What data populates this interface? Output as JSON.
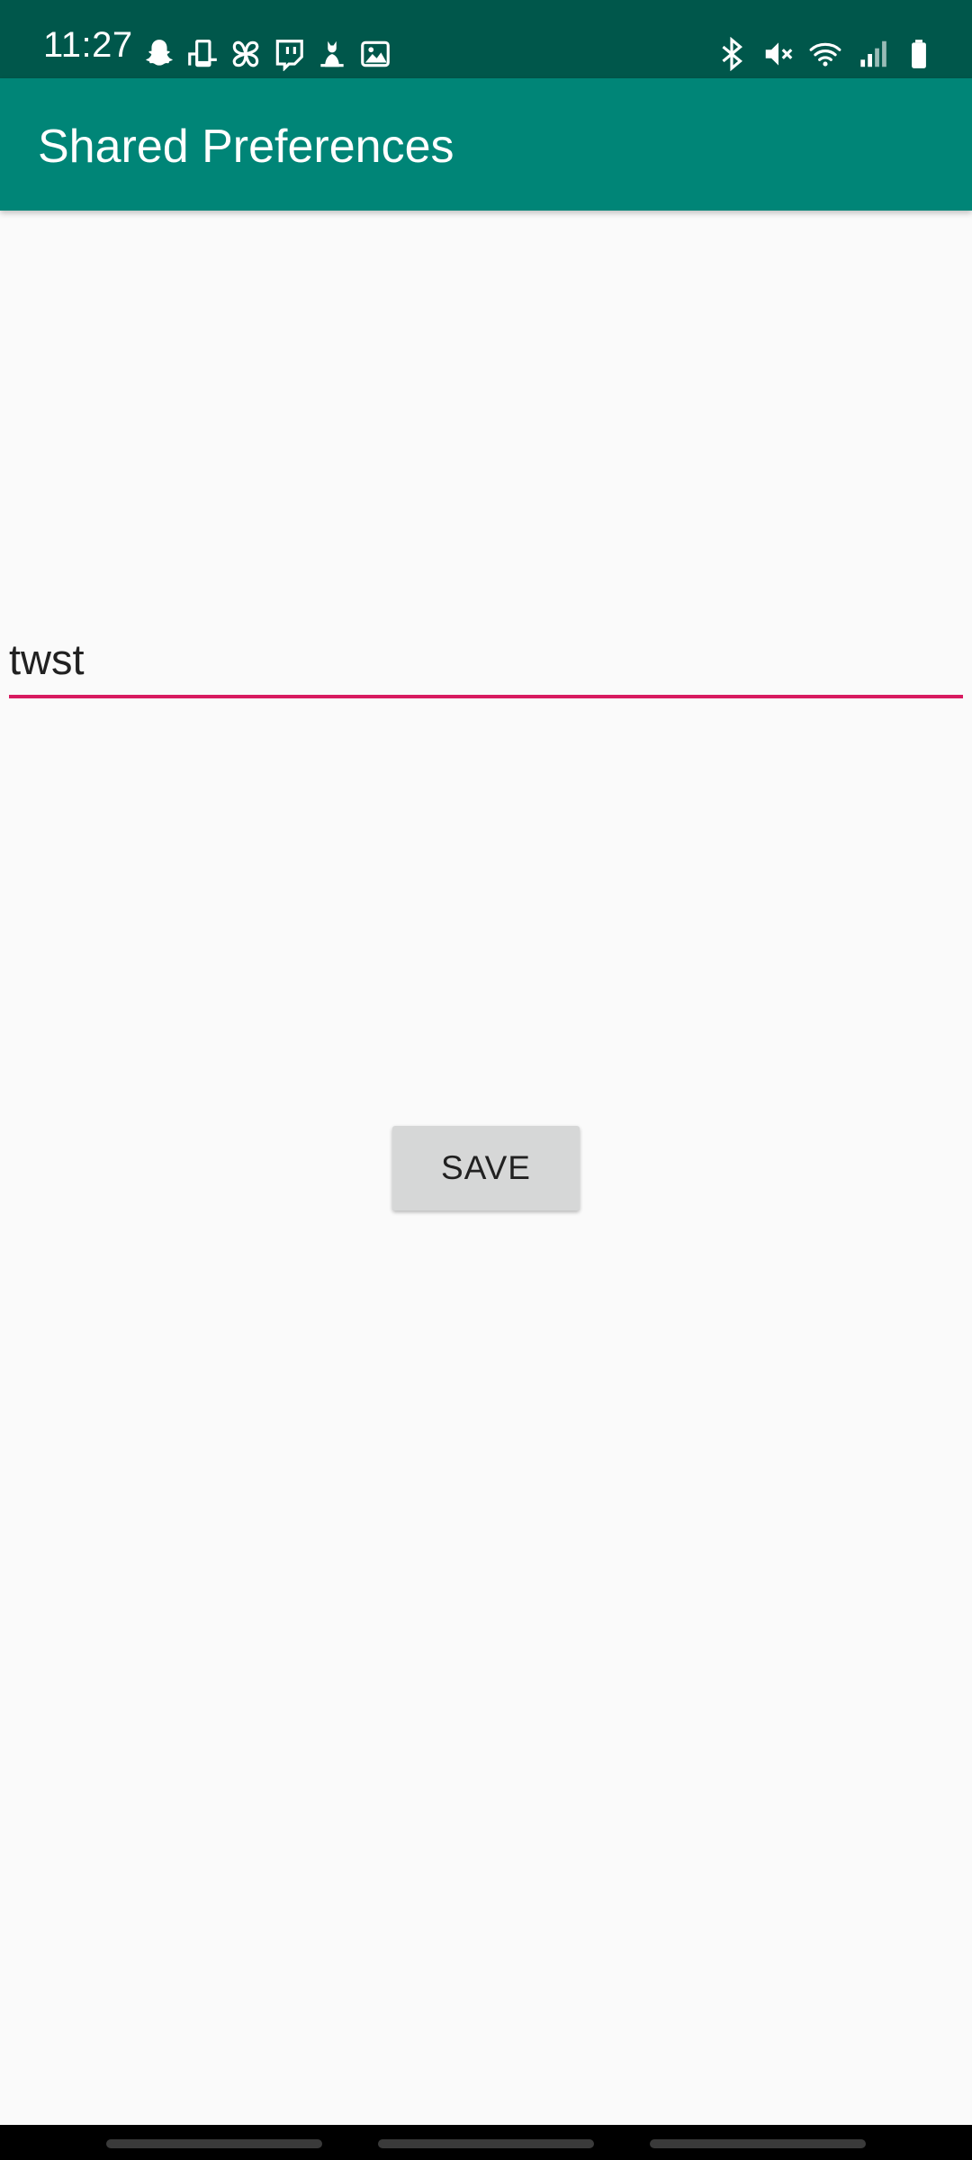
{
  "status_bar": {
    "time": "11:27",
    "left_icons": [
      "snapchat-icon",
      "phone-hand-icon",
      "pinwheel-icon",
      "twitch-icon",
      "cat-icon",
      "image-icon"
    ],
    "right_icons": [
      "bluetooth-icon",
      "mute-icon",
      "wifi-icon",
      "signal-icon",
      "battery-icon"
    ],
    "colors": {
      "background": "#00574B",
      "foreground": "#FFFFFF"
    }
  },
  "app_bar": {
    "title": "Shared Preferences",
    "color": "#008577"
  },
  "main": {
    "edit_text": {
      "value": "twst",
      "underline_color": "#D81B60"
    },
    "save_button": {
      "label": "SAVE"
    }
  },
  "nav_bar": {
    "items": [
      "recents-pill",
      "home-pill",
      "back-pill"
    ]
  }
}
